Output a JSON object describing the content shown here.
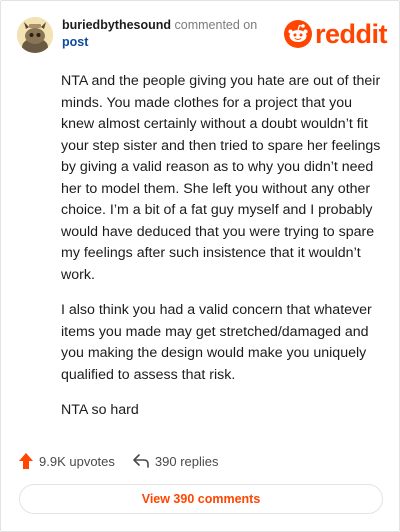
{
  "comment": {
    "username": "buriedbythesound",
    "action_text": "commented on",
    "context_link": "post",
    "paragraphs": [
      "NTA and the people giving you hate are out of their minds. You made clothes for a project that you knew almost certainly without a doubt wouldn’t fit your step sister and then tried to spare her feelings by giving a valid reason as to why you didn’t need her to model them. She left you without any other choice. I’m a bit of a fat guy myself and I probably would have deduced that you were trying to spare my feelings after such insistence that it wouldn’t work.",
      "I also think you had a valid concern that whatever items you made may get stretched/damaged and you making the design would make you uniquely qualified to assess that risk.",
      "NTA so hard"
    ]
  },
  "brand": {
    "wordmark": "reddit",
    "color": "#ff4500"
  },
  "stats": {
    "upvotes": "9.9K upvotes",
    "replies": "390 replies"
  },
  "view_button": {
    "label": "View 390 comments"
  },
  "icons": {
    "avatar": "snoo-avatar-icon",
    "logo": "reddit-snoo-icon",
    "upvote": "upvote-arrow-icon",
    "reply": "reply-arrow-icon"
  }
}
